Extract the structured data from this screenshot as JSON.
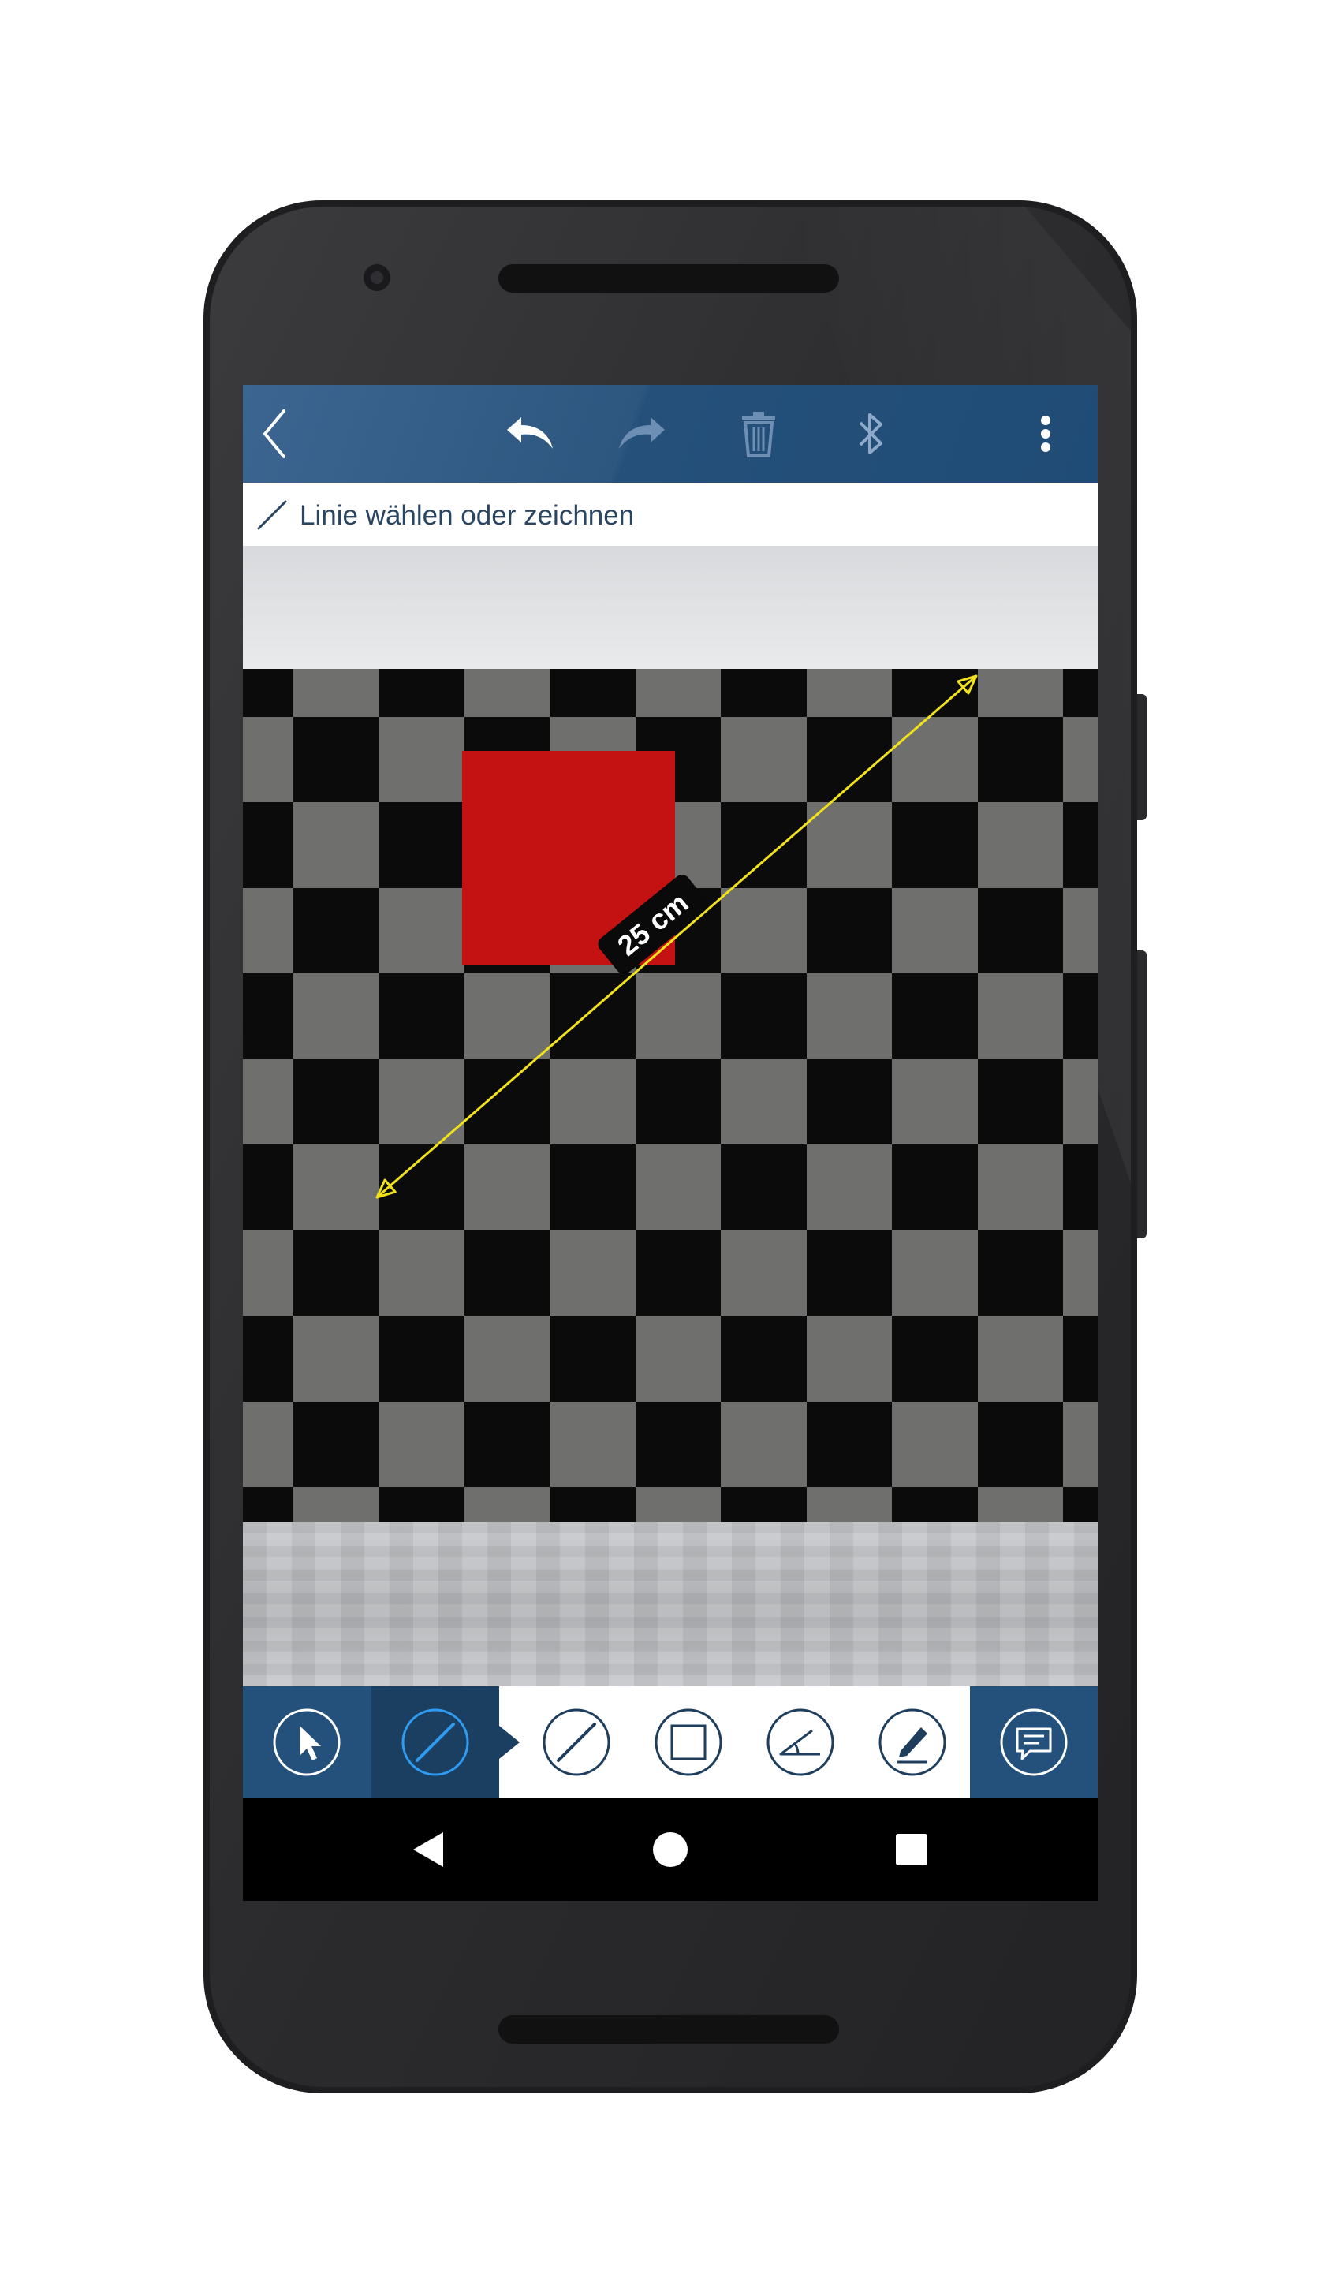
{
  "toolbar": {
    "back_icon": "chevron-left-icon",
    "undo_icon": "undo-icon",
    "redo_icon": "redo-icon",
    "delete_icon": "trash-icon",
    "bluetooth_icon": "bluetooth-icon",
    "menu_icon": "more-vert-icon",
    "redo_enabled": false,
    "delete_enabled": false,
    "colors": {
      "bar": "#2d577f",
      "icon_active": "#ffffff",
      "icon_disabled": "#6c8fb3"
    }
  },
  "hint": {
    "icon": "line-icon",
    "text": "Linie wählen oder zeichnen"
  },
  "canvas": {
    "measurement": {
      "label": "25 cm",
      "line_color": "#f2e21a"
    },
    "colors": {
      "checker_dark": "#0b0b0c",
      "checker_light": "#6f706e",
      "red_square": "#c41212"
    }
  },
  "bottom_toolbar": {
    "left_tools": [
      {
        "name": "select-tool",
        "icon": "cursor-arrow-icon",
        "active": false
      },
      {
        "name": "line-tool",
        "icon": "line-icon",
        "active": true
      }
    ],
    "submenu_tools": [
      {
        "name": "line-tool-option",
        "icon": "line-icon"
      },
      {
        "name": "rectangle-tool",
        "icon": "rectangle-icon"
      },
      {
        "name": "angle-tool",
        "icon": "angle-icon"
      },
      {
        "name": "pencil-tool",
        "icon": "pencil-icon"
      }
    ],
    "right_tool": {
      "name": "comment-tool",
      "icon": "comment-icon"
    },
    "colors": {
      "bar": "#24517b",
      "active": "#1b3f61",
      "active_accent": "#2f9bf0",
      "submenu_icon": "#1f3e5e"
    }
  },
  "navigation": {
    "back_icon": "nav-back-icon",
    "home_icon": "nav-home-icon",
    "recents_icon": "nav-recents-icon"
  }
}
